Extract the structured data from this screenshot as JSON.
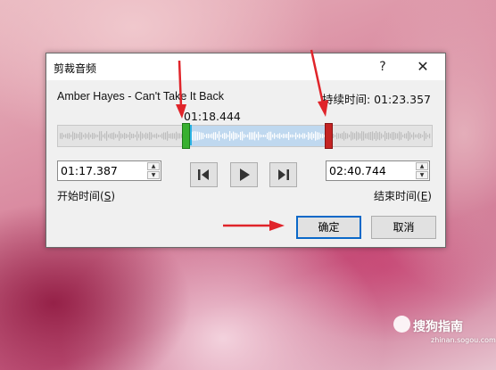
{
  "dialog": {
    "title": "剪裁音频",
    "help_label": "?",
    "close_label": "✕",
    "song_title": "Amber Hayes - Can't Take It Back",
    "duration_label": "持续时间: 01:23.357",
    "current_time": "01:18.444",
    "start_time": "01:17.387",
    "end_time": "02:40.744",
    "start_label_text": "开始时间(",
    "start_label_key": "S",
    "start_label_close": ")",
    "end_label_text": "结束时间(",
    "end_label_key": "E",
    "end_label_close": ")",
    "ok_label": "确定",
    "cancel_label": "取消"
  },
  "watermark": {
    "brand": "搜狗指南",
    "url": "zhinan.sogou.com"
  },
  "icons": {
    "prev_frame": "skip-back-icon",
    "play": "play-icon",
    "next_frame": "skip-forward-icon"
  },
  "colors": {
    "selection": "#bfd8ef",
    "start_marker": "#38b030",
    "end_marker": "#c42424",
    "playhead": "#2bb3e6",
    "ok_border": "#0a68c8",
    "annotation_arrow": "#e0242a"
  }
}
